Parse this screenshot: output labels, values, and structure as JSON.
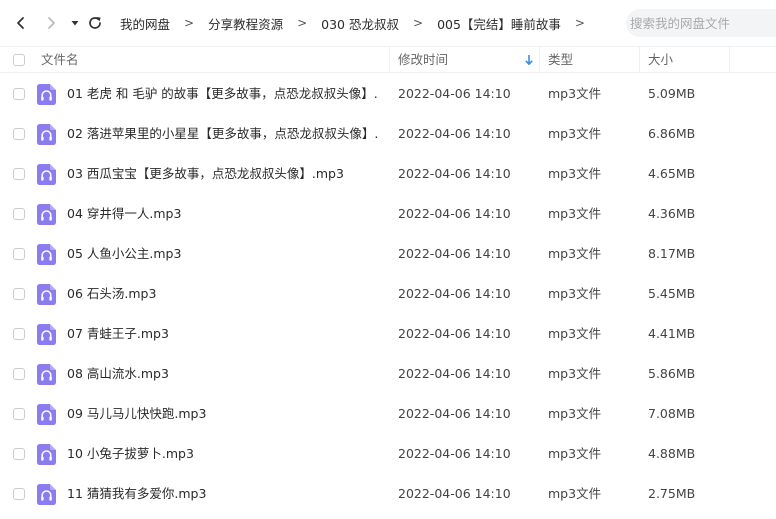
{
  "nav": {
    "breadcrumbs": [
      "我的网盘",
      "分享教程资源",
      "030 恐龙叔叔",
      "005【完结】睡前故事"
    ],
    "separator": ">",
    "search_placeholder": "搜索我的网盘文件"
  },
  "table": {
    "headers": {
      "name": "文件名",
      "modified": "修改时间",
      "type": "类型",
      "size": "大小"
    },
    "rows": [
      {
        "name": "01 老虎 和 毛驴 的故事【更多故事，点恐龙叔叔头像】....",
        "modified": "2022-04-06 14:10",
        "type": "mp3文件",
        "size": "5.09MB"
      },
      {
        "name": "02 落进苹果里的小星星【更多故事，点恐龙叔叔头像】....",
        "modified": "2022-04-06 14:10",
        "type": "mp3文件",
        "size": "6.86MB"
      },
      {
        "name": "03 西瓜宝宝【更多故事，点恐龙叔叔头像】.mp3",
        "modified": "2022-04-06 14:10",
        "type": "mp3文件",
        "size": "4.65MB"
      },
      {
        "name": "04 穿井得一人.mp3",
        "modified": "2022-04-06 14:10",
        "type": "mp3文件",
        "size": "4.36MB"
      },
      {
        "name": "05 人鱼小公主.mp3",
        "modified": "2022-04-06 14:10",
        "type": "mp3文件",
        "size": "8.17MB"
      },
      {
        "name": "06 石头汤.mp3",
        "modified": "2022-04-06 14:10",
        "type": "mp3文件",
        "size": "5.45MB"
      },
      {
        "name": "07 青蛙王子.mp3",
        "modified": "2022-04-06 14:10",
        "type": "mp3文件",
        "size": "4.41MB"
      },
      {
        "name": "08 高山流水.mp3",
        "modified": "2022-04-06 14:10",
        "type": "mp3文件",
        "size": "5.86MB"
      },
      {
        "name": "09 马儿马儿快快跑.mp3",
        "modified": "2022-04-06 14:10",
        "type": "mp3文件",
        "size": "7.08MB"
      },
      {
        "name": "10 小兔子拔萝卜.mp3",
        "modified": "2022-04-06 14:10",
        "type": "mp3文件",
        "size": "4.88MB"
      },
      {
        "name": "11 猜猜我有多爱你.mp3",
        "modified": "2022-04-06 14:10",
        "type": "mp3文件",
        "size": "2.75MB"
      }
    ]
  },
  "colors": {
    "accent": "#3a8ee6",
    "file_icon": "#8b7cf0",
    "header_text": "#666666"
  },
  "icons": [
    "back-arrow-icon",
    "forward-arrow-icon",
    "history-dropdown-icon",
    "refresh-icon",
    "audio-file-icon",
    "sort-desc-icon"
  ]
}
